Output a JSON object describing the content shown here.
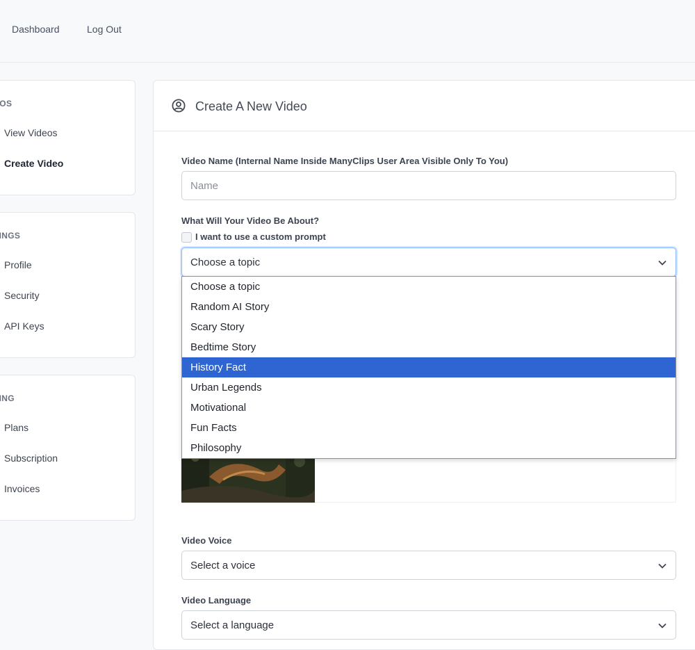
{
  "topbar": {
    "nav": [
      "Dashboard",
      "Log Out"
    ]
  },
  "sidebar": {
    "sections": [
      {
        "heading": "EOS",
        "items": [
          "View Videos",
          "Create Video"
        ],
        "active": "Create Video"
      },
      {
        "heading": "TINGS",
        "items": [
          "Profile",
          "Security",
          "API Keys"
        ]
      },
      {
        "heading": "LING",
        "items": [
          "Plans",
          "Subscription",
          "Invoices"
        ]
      }
    ]
  },
  "main": {
    "title": "Create A New Video",
    "video_name": {
      "label": "Video Name (Internal Name Inside ManyClips User Area Visible Only To You)",
      "placeholder": "Name",
      "value": ""
    },
    "topic": {
      "label": "What Will Your Video Be About?",
      "custom_prompt_label": "I want to use a custom prompt",
      "custom_prompt_checked": false,
      "selected": "Choose a topic",
      "options": [
        "Choose a topic",
        "Random AI Story",
        "Scary Story",
        "Bedtime Story",
        "History Fact",
        "Urban Legends",
        "Motivational",
        "Fun Facts",
        "Philosophy"
      ],
      "highlighted_option": "History Fact"
    },
    "voice": {
      "label": "Video Voice",
      "selected": "Select a voice"
    },
    "language": {
      "label": "Video Language",
      "selected": "Select a language"
    }
  },
  "colors": {
    "highlight": "#2f65d2",
    "focus_ring": "#86b7fe"
  }
}
